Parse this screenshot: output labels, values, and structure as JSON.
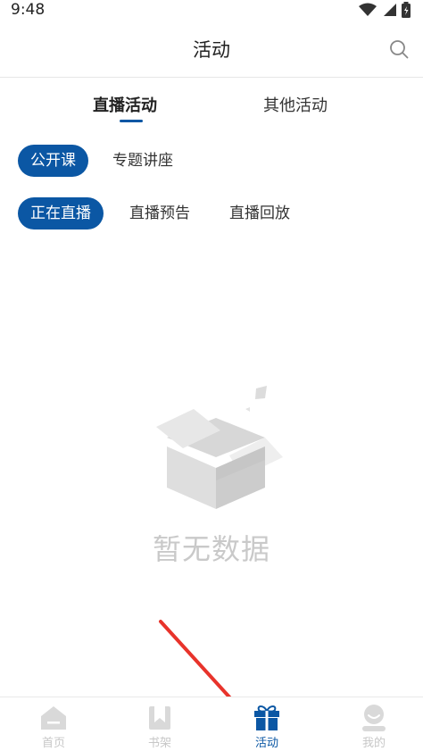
{
  "status": {
    "time": "9:48"
  },
  "header": {
    "title": "活动",
    "search_icon": "search-icon"
  },
  "tabs": [
    {
      "label": "直播活动",
      "active": true
    },
    {
      "label": "其他活动",
      "active": false
    }
  ],
  "filters_row1": [
    {
      "label": "公开课",
      "active": true
    },
    {
      "label": "专题讲座",
      "active": false
    }
  ],
  "filters_row2": [
    {
      "label": "正在直播",
      "active": true
    },
    {
      "label": "直播预告",
      "active": false
    },
    {
      "label": "直播回放",
      "active": false
    }
  ],
  "empty": {
    "text": "暂无数据",
    "icon": "empty-box-icon"
  },
  "bottom_nav": [
    {
      "label": "首页",
      "icon": "home-icon",
      "active": false
    },
    {
      "label": "书架",
      "icon": "bookmark-icon",
      "active": false
    },
    {
      "label": "活动",
      "icon": "gift-icon",
      "active": true
    },
    {
      "label": "我的",
      "icon": "user-icon",
      "active": false
    }
  ],
  "colors": {
    "accent": "#0b57a4",
    "annotation_arrow": "#e8332b",
    "inactive_nav": "#c7c7c7"
  }
}
